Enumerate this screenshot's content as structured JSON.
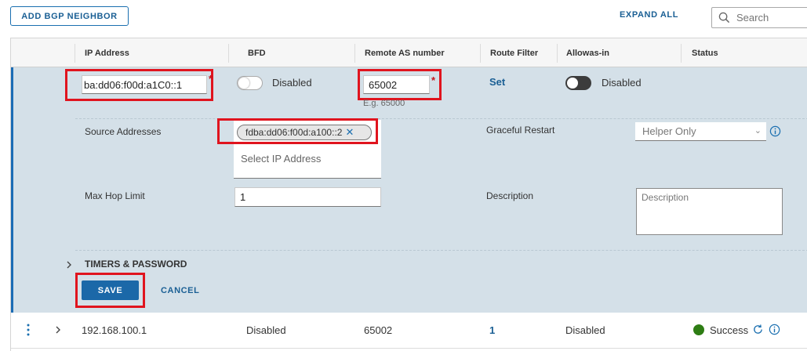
{
  "toolbar": {
    "add_button": "ADD BGP NEIGHBOR",
    "expand_all": "EXPAND ALL",
    "search_placeholder": "Search"
  },
  "table": {
    "columns": [
      "IP Address",
      "BFD",
      "Remote AS number",
      "Route Filter",
      "Allowas-in",
      "Status"
    ]
  },
  "editor": {
    "ip_address_value": "ba:dd06:f00d:a1C0::1",
    "bfd_state": "Disabled",
    "remote_as_value": "65002",
    "remote_as_hint": "E.g. 65000",
    "route_filter_link": "Set",
    "allowas_state": "Disabled",
    "required_mark": "*",
    "source_addresses_label": "Source Addresses",
    "source_address_chip": "fdba:dd06:f00d:a100::2",
    "select_ip_placeholder": "Select IP Address",
    "graceful_restart_label": "Graceful Restart",
    "graceful_restart_value": "Helper Only",
    "max_hop_label": "Max Hop Limit",
    "max_hop_value": "1",
    "description_label": "Description",
    "description_placeholder": "Description",
    "timers_label": "TIMERS & PASSWORD",
    "save_label": "SAVE",
    "cancel_label": "CANCEL"
  },
  "rows": [
    {
      "ip": "192.168.100.1",
      "bfd": "Disabled",
      "remote_as": "65002",
      "route_filter": "1",
      "allowas": "Disabled",
      "status": "Success"
    }
  ],
  "colors": {
    "accent": "#1b68a8",
    "expanded_bg": "#d4e0e8",
    "highlight": "#e0141e",
    "success": "#2e7d14"
  },
  "icons": [
    "search-icon",
    "chevron-right-icon",
    "chevron-down-icon",
    "info-icon",
    "close-icon",
    "more-vertical-icon",
    "refresh-icon"
  ]
}
